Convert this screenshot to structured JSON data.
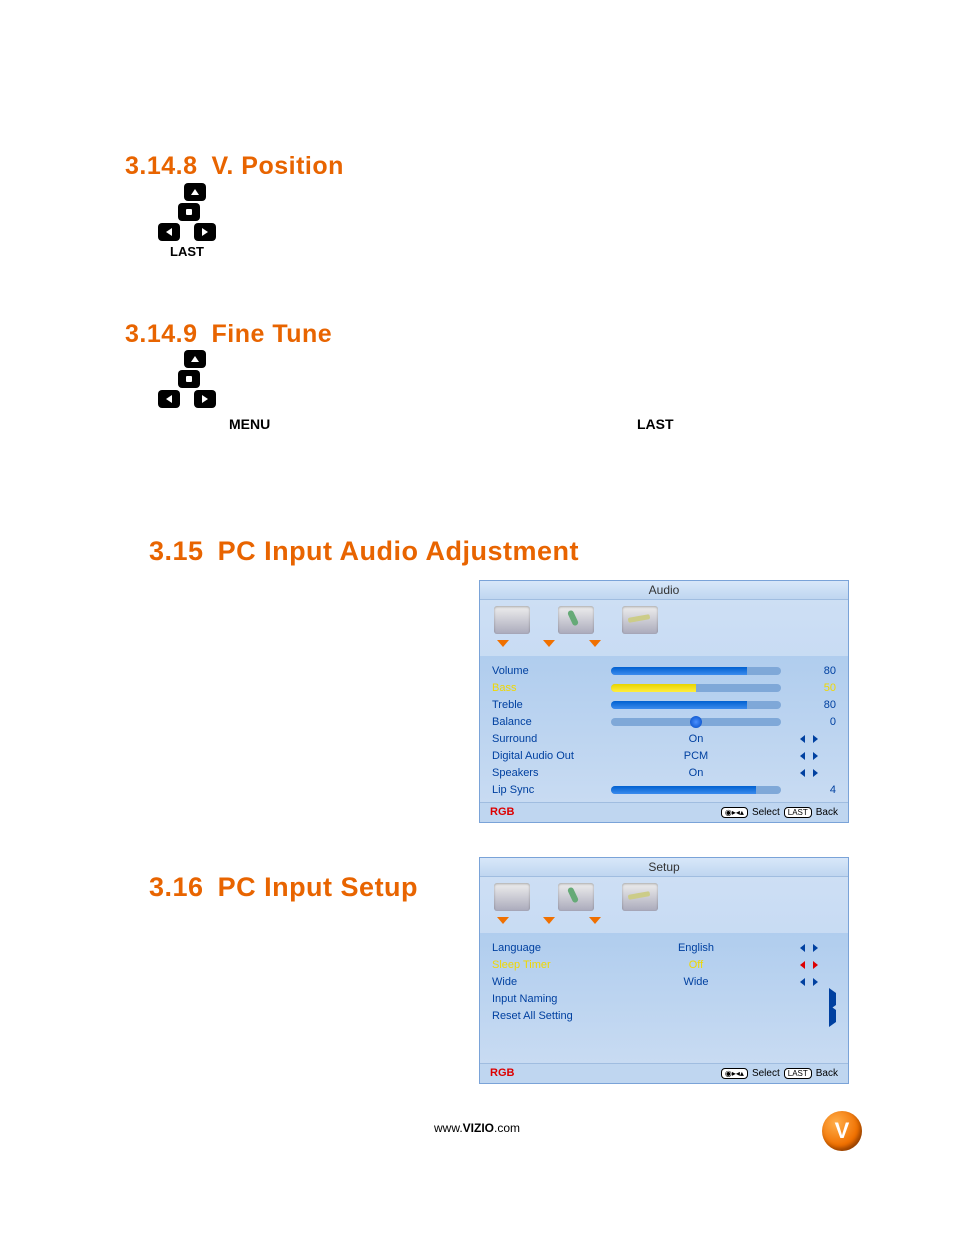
{
  "s1": {
    "num": "3.14.8",
    "title": "V. Position",
    "dpad_caption": "LAST"
  },
  "s2": {
    "num": "3.14.9",
    "title": "Fine Tune",
    "menu_label": "MENU",
    "last_label": "LAST"
  },
  "s3": {
    "num": "3.15",
    "title": "PC Input Audio Adjustment"
  },
  "s4": {
    "num": "3.16",
    "title": "PC Input Setup"
  },
  "osd_audio": {
    "title": "Audio",
    "rows": [
      {
        "label": "Volume",
        "kind": "bar",
        "fill": 80,
        "value": "80"
      },
      {
        "label": "Bass",
        "kind": "bar",
        "fill": 50,
        "value": "50",
        "highlight": true,
        "yellow_bar": true
      },
      {
        "label": "Treble",
        "kind": "bar",
        "fill": 80,
        "value": "80"
      },
      {
        "label": "Balance",
        "kind": "balance",
        "pos": 50,
        "value": "0"
      },
      {
        "label": "Surround",
        "kind": "opt",
        "center": "On"
      },
      {
        "label": "Digital Audio Out",
        "kind": "opt",
        "center": "PCM"
      },
      {
        "label": "Speakers",
        "kind": "opt",
        "center": "On"
      },
      {
        "label": "Lip Sync",
        "kind": "bar",
        "fill": 85,
        "value": "4"
      }
    ],
    "footer_left": "RGB",
    "footer_select": "Select",
    "footer_back": "Back",
    "footer_last": "LAST"
  },
  "osd_setup": {
    "title": "Setup",
    "rows": [
      {
        "label": "Language",
        "kind": "opt",
        "center": "English"
      },
      {
        "label": "Sleep Timer",
        "kind": "opt",
        "center": "Off",
        "highlight": true
      },
      {
        "label": "Wide",
        "kind": "opt",
        "center": "Wide"
      },
      {
        "label": "Input Naming",
        "kind": "go"
      },
      {
        "label": "Reset All Setting",
        "kind": "go"
      }
    ],
    "footer_left": "RGB",
    "footer_select": "Select",
    "footer_back": "Back",
    "footer_last": "LAST"
  },
  "footer": {
    "url_prefix": "www.",
    "url_bold": "VIZIO",
    "url_suffix": ".com",
    "badge": "V"
  }
}
